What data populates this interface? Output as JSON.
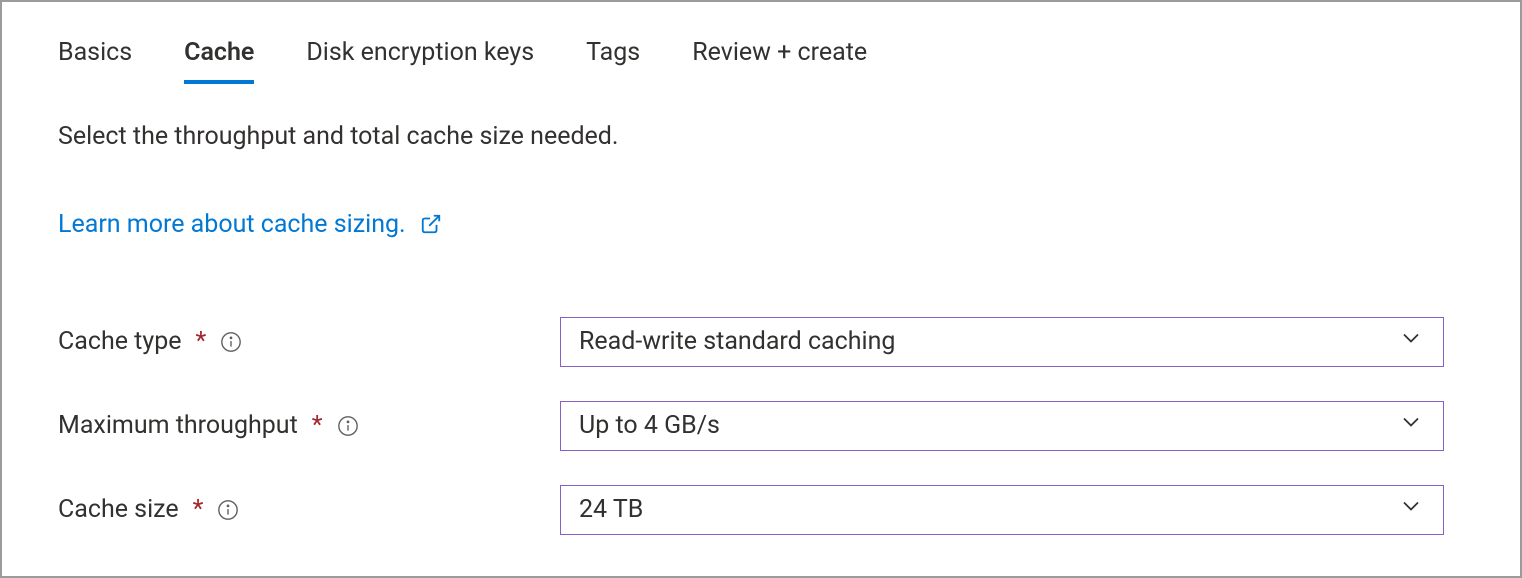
{
  "tabs": {
    "basics": "Basics",
    "cache": "Cache",
    "disk_encryption_keys": "Disk encryption keys",
    "tags": "Tags",
    "review_create": "Review + create"
  },
  "description": "Select the throughput and total cache size needed.",
  "link": {
    "text": "Learn more about cache sizing."
  },
  "form": {
    "cache_type": {
      "label": "Cache type",
      "value": "Read-write standard caching"
    },
    "max_throughput": {
      "label": "Maximum throughput",
      "value": "Up to 4 GB/s"
    },
    "cache_size": {
      "label": "Cache size",
      "value": "24 TB"
    }
  }
}
